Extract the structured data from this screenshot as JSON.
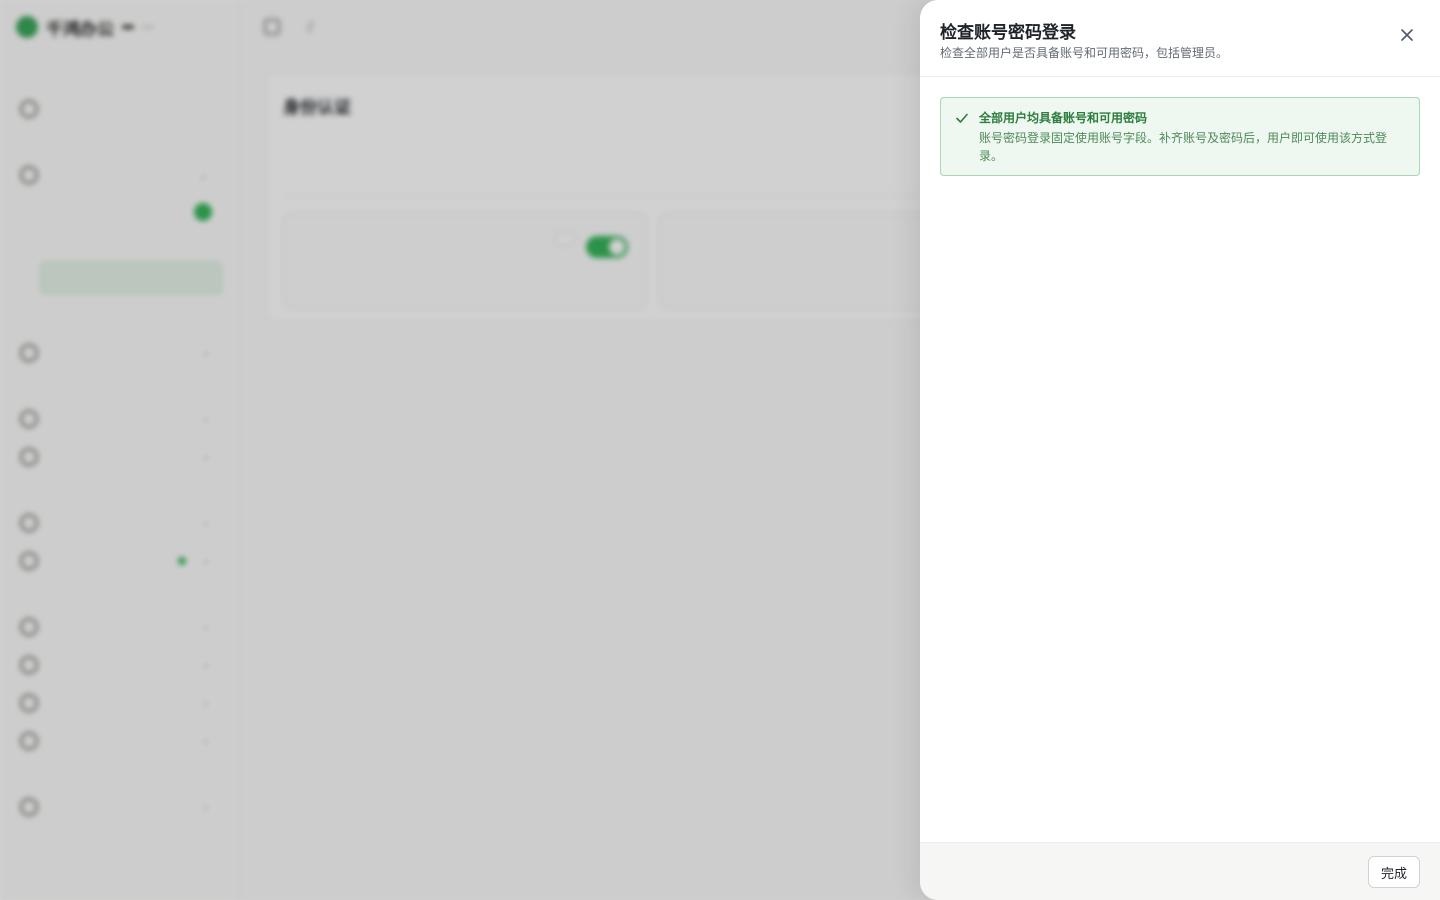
{
  "background": {
    "brand": {
      "name": "千鸿办公",
      "badge": "",
      "badge2": ""
    },
    "sidebar": {
      "groups": [],
      "items": [],
      "sub_items": []
    },
    "user": {
      "name": "",
      "email": ""
    },
    "breadcrumb": [],
    "page": {
      "title": "身份认证",
      "subtitle": "",
      "tabs": [],
      "methods": []
    }
  },
  "drawer": {
    "title": "检查账号密码登录",
    "subtitle": "检查全部用户是否具备账号和可用密码，包括管理员。",
    "close_icon": "close-icon",
    "alert": {
      "icon": "check-icon",
      "title": "全部用户均具备账号和可用密码",
      "body": "账号密码登录固定使用账号字段。补齐账号及密码后，用户即可使用该方式登录。",
      "color": "#2e7d3e"
    },
    "footer": {
      "done_label": "完成"
    }
  }
}
